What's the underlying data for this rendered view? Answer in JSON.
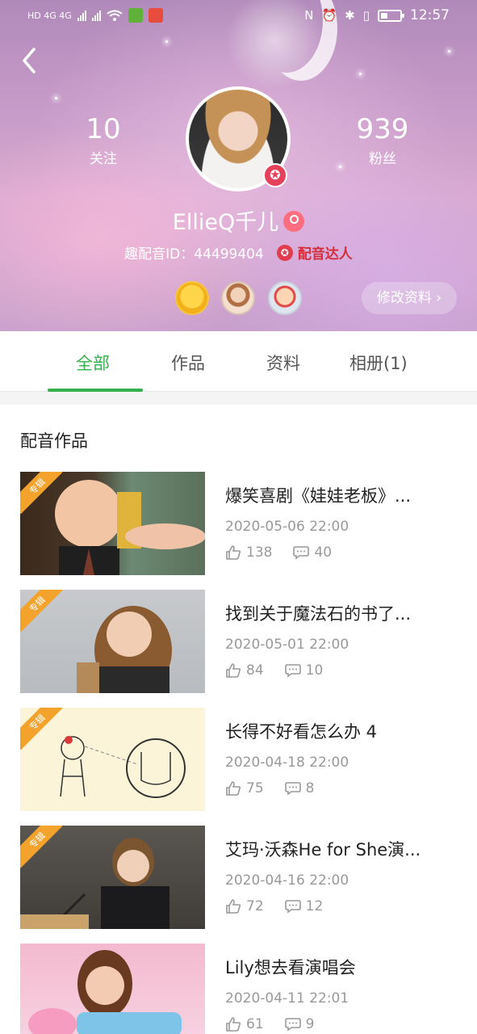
{
  "status_bar": {
    "left_indicators": "HD 4G 4G",
    "time": "12:57"
  },
  "profile": {
    "following_count": "10",
    "following_label": "关注",
    "fans_count": "939",
    "fans_label": "粉丝",
    "username": "EllieQ千儿",
    "id_label": "趣配音ID：",
    "id_value": "44499404",
    "verified_label": "配音达人",
    "edit_button": "修改资料",
    "edit_arrow": "›"
  },
  "tabs": [
    {
      "label": "全部",
      "active": true
    },
    {
      "label": "作品",
      "active": false
    },
    {
      "label": "资料",
      "active": false
    },
    {
      "label": "相册(1)",
      "active": false
    }
  ],
  "section_title": "配音作品",
  "ribbon_label": "专辑",
  "works": [
    {
      "title": "爆笑喜剧《娃娃老板》...",
      "date": "2020-05-06 22:00",
      "likes": "138",
      "comments": "40"
    },
    {
      "title": "找到关于魔法石的书了...",
      "date": "2020-05-01 22:00",
      "likes": "84",
      "comments": "10"
    },
    {
      "title": "长得不好看怎么办 4",
      "date": "2020-04-18 22:00",
      "likes": "75",
      "comments": "8"
    },
    {
      "title": "艾玛·沃森He for She演...",
      "date": "2020-04-16 22:00",
      "likes": "72",
      "comments": "12"
    },
    {
      "title": "Lily想去看演唱会",
      "date": "2020-04-11 22:01",
      "likes": "61",
      "comments": "9"
    }
  ],
  "colors": {
    "accent_green": "#33b14a",
    "verified_red": "#d42e3d",
    "ribbon_orange": "#f3a22c"
  }
}
